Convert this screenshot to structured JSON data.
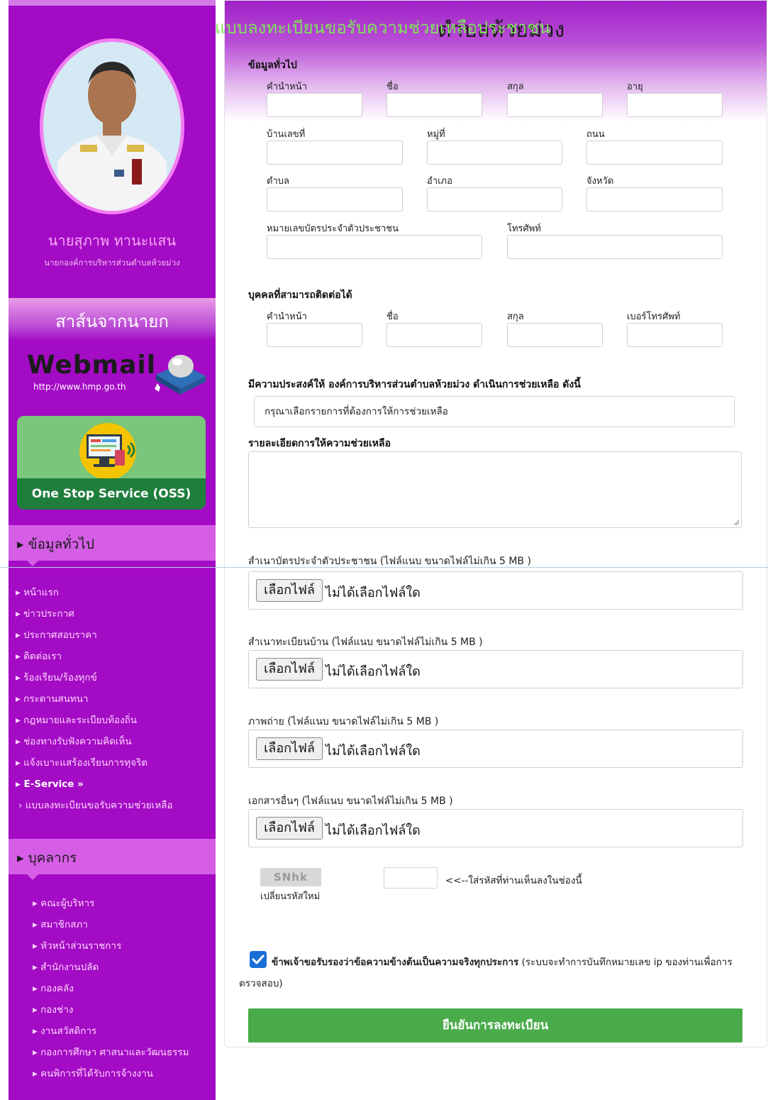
{
  "sidebar": {
    "mayor_name": "นายสุภาพ ทานะแสน",
    "mayor_title": "นายกองค์การบริหารส่วนตำบลห้วยม่วง",
    "message_banner": "สาส์นจากนายก",
    "webmail_title": "Webmail",
    "webmail_url": "http://www.hmp.go.th",
    "oss_label": "One Stop Service (OSS)",
    "section_general": "ข้อมูลทั่วไป",
    "nav_items": [
      "หน้าแรก",
      "ข่าวประกาศ",
      "ประกาศสอบราคา",
      "ติดต่อเรา",
      "ร้องเรียน/ร้องทุกข์",
      "กระดานสนทนา",
      "กฎหมายและระเบียบท้องถิ่น",
      "ช่องทางรับฟังความคิดเห็น",
      "แจ้งเบาะแสร้องเรียนการทุจริต"
    ],
    "eservice_label": "E-Service »",
    "eservice_sub": "› แบบลงทะเบียนขอรับความช่วยเหลือ",
    "section_personnel": "บุคลากร",
    "personnel_items": [
      "คณะผู้บริหาร",
      "สมาชิกสภา",
      "หัวหน้าส่วนราชการ",
      "สำนักงานปลัด",
      "กองคลัง",
      "กองช่าง",
      "งานสวัสดิการ",
      "กองการศึกษา ศาสนาและวัฒนธรรม",
      "คนพิการที่ได้รับการจ้างงาน"
    ],
    "bullet": "▸"
  },
  "main": {
    "title_overlay": "แบบลงทะเบียนขอรับความช่วยเหลือประชาชน",
    "title_bg": "ตำบลห้วยม่วง",
    "general_title": "ข้อมูลทั่วไป",
    "labels": {
      "prefix": "คำนำหน้า",
      "first_name": "ชื่อ",
      "last_name": "สกุล",
      "age": "อายุ",
      "house_no": "บ้านเลขที่",
      "moo": "หมู่ที่",
      "road": "ถนน",
      "tambon": "ตำบล",
      "amphoe": "อำเภอ",
      "province": "จังหวัด",
      "citizen_id": "หมายเลขบัตรประจำตัวประชาชน",
      "phone": "โทรศัพท์"
    },
    "contact_title": "บุคคลที่สามารถติดต่อได้",
    "contact_labels": {
      "prefix": "คำนำหน้า",
      "first_name": "ชื่อ",
      "last_name": "สกุล",
      "phone": "เบอร์โทรศัพท์"
    },
    "purpose_title": "มีความประสงค์ให้ องค์การบริหารส่วนตำบลห้วยม่วง ดำเนินการช่วยเหลือ ดังนี้",
    "help_select": "กรุณาเลือกรายการที่ต้องการให้การช่วยเหลือ",
    "detail_title": "รายละเอียดการให้ความช่วยเหลือ",
    "files": [
      {
        "label": "สำเนาบัตรประจำตัวประชาชน (ไฟล์แนบ ขนาดไฟล์ไม่เกิน 5 MB )"
      },
      {
        "label": "สำเนาทะเบียนบ้าน (ไฟล์แนบ ขนาดไฟล์ไม่เกิน 5 MB )"
      },
      {
        "label": "ภาพถ่าย (ไฟล์แนบ ขนาดไฟล์ไม่เกิน 5 MB )"
      },
      {
        "label": "เอกสารอื่นๆ (ไฟล์แนบ ขนาดไฟล์ไม่เกิน 5 MB )"
      }
    ],
    "file_button": "เลือกไฟล์",
    "file_none": "ไม่ได้เลือกไฟล์ใด",
    "captcha_code": "SNhk",
    "captcha_refresh": "เปลี่ยนรหัสใหม่",
    "captcha_hint": "<<--ใส่รหัสที่ท่านเห็นลงในช่องนี้",
    "agree_bold": "ข้าพเจ้าขอรับรองว่าข้อความข้างต้นเป็นความจริงทุกประการ",
    "agree_rest": " (ระบบจะทำการบันทึกหมายเลข ip ของท่านเพื่อการตรวจสอบ)",
    "submit": "ยืนยันการลงทะเบียน"
  },
  "colors": {
    "sidebar": "#a30bc4",
    "accent_pink": "#d65ee6",
    "submit_green": "#4aab4a",
    "check_blue": "#1a6fd6"
  }
}
